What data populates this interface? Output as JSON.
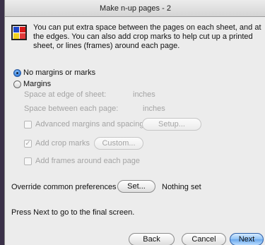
{
  "window": {
    "title": "Make n-up pages - 2"
  },
  "intro": {
    "text": "You can put extra space between the pages on each sheet, and at the edges. You can also add crop marks to help cut up a printed sheet, or lines (frames) around each page."
  },
  "options": {
    "no_margins": {
      "label": "No margins or marks",
      "selected": true
    },
    "margins": {
      "label": "Margins",
      "selected": false
    },
    "edge": {
      "label": "Space at edge of sheet:",
      "unit": "inches"
    },
    "between": {
      "label": "Space between each page:",
      "unit": "inches"
    },
    "advanced": {
      "label": "Advanced margins and spacing",
      "checked": false,
      "button": "Setup..."
    },
    "crop": {
      "label": "Add crop marks",
      "checked": true,
      "button": "Custom..."
    },
    "frames": {
      "label": "Add frames around each page",
      "checked": false
    }
  },
  "override": {
    "label": "Override common preferences",
    "button": "Set...",
    "status": "Nothing set"
  },
  "footer": {
    "hint": "Press Next to go to the final screen."
  },
  "buttons": {
    "back": "Back",
    "cancel": "Cancel",
    "next": "Next"
  }
}
